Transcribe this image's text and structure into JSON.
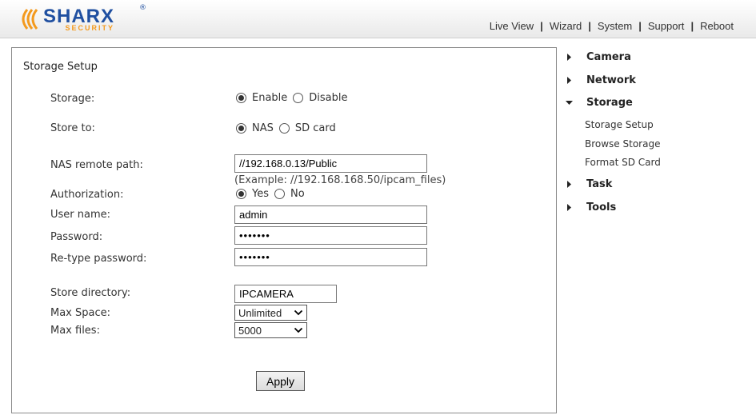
{
  "brand": {
    "name": "SHARX",
    "tagline": "SECURITY",
    "registered": "®",
    "colors": {
      "primary": "#1f4fa0",
      "accent": "#f39a1e"
    }
  },
  "topnav": {
    "items": [
      "Live View",
      "Wizard",
      "System",
      "Support",
      "Reboot"
    ],
    "separator": "|"
  },
  "form": {
    "title": "Storage Setup",
    "storage": {
      "label": "Storage:",
      "options": [
        "Enable",
        "Disable"
      ],
      "selected": "Enable"
    },
    "store_to": {
      "label": "Store to:",
      "options": [
        "NAS",
        "SD card"
      ],
      "selected": "NAS"
    },
    "nas_path": {
      "label": "NAS remote path:",
      "value": "//192.168.0.13/Public",
      "example": "(Example: //192.168.168.50/ipcam_files)"
    },
    "authorization": {
      "label": "Authorization:",
      "options": [
        "Yes",
        "No"
      ],
      "selected": "Yes"
    },
    "user_name": {
      "label": "User name:",
      "value": "admin"
    },
    "password": {
      "label": "Password:",
      "value": "•••••••"
    },
    "retype_password": {
      "label": "Re-type password:",
      "value": "•••••••"
    },
    "store_directory": {
      "label": "Store directory:",
      "value": "IPCAMERA"
    },
    "max_space": {
      "label": "Max Space:",
      "value": "Unlimited"
    },
    "max_files": {
      "label": "Max files:",
      "value": "5000"
    },
    "apply_label": "Apply"
  },
  "sidebar": {
    "sections": [
      {
        "label": "Camera",
        "expanded": false,
        "icon": "triangle-right-icon"
      },
      {
        "label": "Network",
        "expanded": false,
        "icon": "triangle-right-icon"
      },
      {
        "label": "Storage",
        "expanded": true,
        "icon": "triangle-down-icon"
      },
      {
        "label": "Task",
        "expanded": false,
        "icon": "triangle-right-icon"
      },
      {
        "label": "Tools",
        "expanded": false,
        "icon": "triangle-right-icon"
      }
    ],
    "storage_items": [
      "Storage Setup",
      "Browse Storage",
      "Format SD Card"
    ]
  }
}
